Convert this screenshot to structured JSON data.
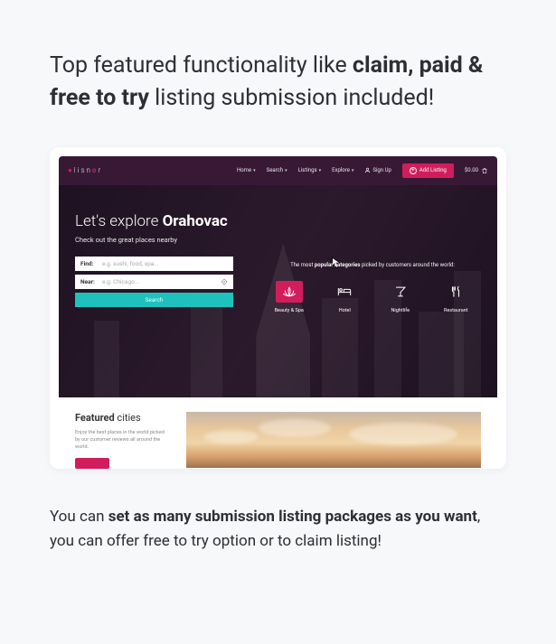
{
  "headline": {
    "pre": "Top featured functionality like ",
    "bold": "claim, paid & free to try",
    "post": " listing submission included!"
  },
  "nav": {
    "logo_pre": "lisn",
    "logo_post": "r",
    "home": "Home",
    "search": "Search",
    "listings": "Listings",
    "explore": "Explore",
    "signup": "Sign Up",
    "add": "Add Listing",
    "price": "$0.00"
  },
  "hero": {
    "title_pre": "Let's explore ",
    "title_bold": "Orahovac",
    "sub": "Check out the great places nearby"
  },
  "search": {
    "find_lbl": "Find:",
    "find_ph": "e.g. sushi, food, spa...",
    "near_lbl": "Near:",
    "near_ph": "e.g. Chicago...",
    "btn": "Search"
  },
  "side": {
    "most_pre": "The most ",
    "most_bold": "popular categories",
    "most_post": " picked by customers around the world:"
  },
  "cats": [
    "Beauty & Spa",
    "Hotel",
    "Nightlife",
    "Restaurant"
  ],
  "featured": {
    "title_bold": "Featured",
    "title_rest": " cities",
    "desc": "Enjoy the best places in the world picked by our customer reviews all around the world."
  },
  "caption": {
    "pre": "You can ",
    "bold": "set as many submission listing packages as you want",
    "post": ", you can offer free to try option or to claim listing!"
  }
}
